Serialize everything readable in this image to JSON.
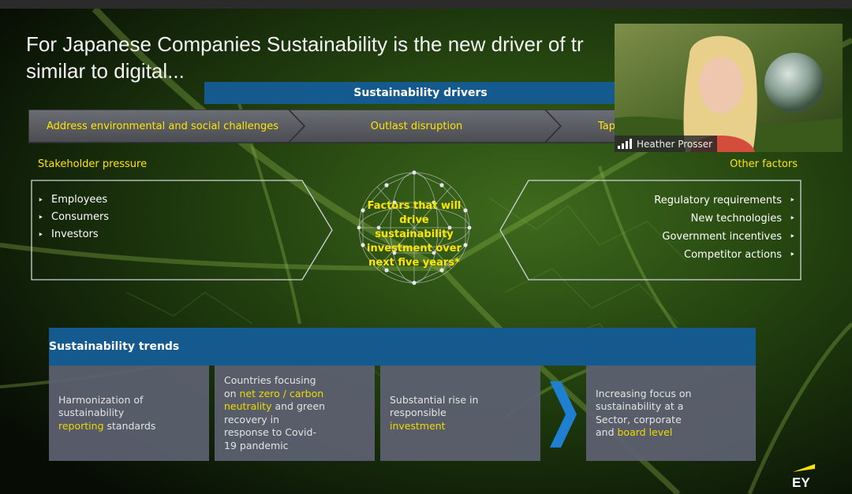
{
  "slide": {
    "title": "For Japanese Companies Sustainability is the new driver of transformation similar to digital...",
    "title_line1": "For Japanese Companies Sustainability is the new driver of tr",
    "title_line2": "similar to digital...",
    "drivers_banner": "Sustainability drivers",
    "chevrons": [
      {
        "label": "Address environmental and social challenges"
      },
      {
        "label": "Outlast disruption"
      },
      {
        "label": "Tap"
      }
    ],
    "stakeholder": {
      "heading": "Stakeholder pressure",
      "items": [
        "Employees",
        "Consumers",
        "Investors"
      ]
    },
    "center": {
      "line1": "Factors that will",
      "line2": "drive sustainability",
      "line3": "investment over",
      "line4": "next five years*"
    },
    "other": {
      "heading": "Other factors",
      "items": [
        "Regulatory requirements",
        "New technologies",
        "Government incentives",
        "Competitor actions"
      ]
    },
    "trends": {
      "heading": "Sustainability trends",
      "card1": {
        "l1": "Harmonization of",
        "l2": "sustainability",
        "hl": "reporting",
        "l3": " standards"
      },
      "card2": {
        "l1": "Countries focusing",
        "l2": "on ",
        "hl1": "net zero / carbon",
        "hl2": "neutrality",
        "l3": " and green",
        "l4": "recovery in",
        "l5": "response to Covid-",
        "l6": "19 pandemic"
      },
      "card3": {
        "l1": "Substantial rise in",
        "l2": "responsible",
        "hl": "investment"
      },
      "card4": {
        "l1": "Increasing focus on",
        "l2": "sustainability at a",
        "l3": "Sector, corporate",
        "l4": "and ",
        "hl": "board level"
      }
    },
    "logo": "EY"
  },
  "video": {
    "participant_name": "Heather Prosser",
    "icon": "signal-bars-icon"
  },
  "colors": {
    "accent_yellow": "#ffe600",
    "banner_blue": "#155a8f",
    "card_gray": "#5d6171",
    "chevron_gray": "#5a5d63"
  }
}
